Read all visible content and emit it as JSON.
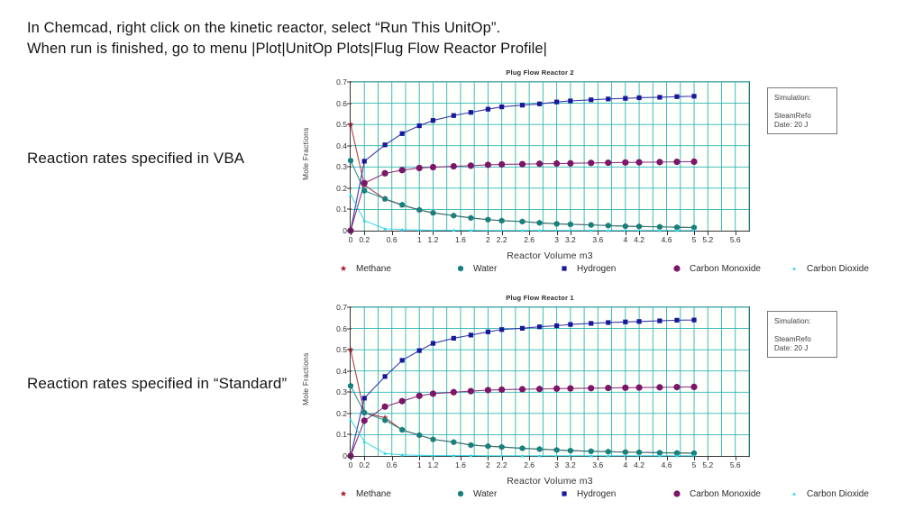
{
  "instructions": {
    "line1": "In Chemcad, right click on the kinetic reactor, select “Run This UnitOp”.",
    "line2": "When run is finished, go to menu |Plot|UnitOp Plots|Flug Flow Reactor Profile|"
  },
  "captions": {
    "chart1": "Reaction rates specified in VBA",
    "chart2": "Reaction rates specified in “Standard”"
  },
  "simulation_box": {
    "label": "Simulation:",
    "value": "SteamRefo",
    "value_clipped": "Date: 20 J"
  },
  "colors": {
    "methane": "#a81f2e",
    "water": "#15807d",
    "hydrogen": "#17199c",
    "carbon_monoxide": "#7b1668",
    "carbon_dioxide": "#2ad4e8",
    "grid": "#2bb5b5",
    "axis": "#333333",
    "plot_bg": "#fffffb"
  },
  "chart_data": [
    {
      "type": "line",
      "title": "Plug Flow Reactor 2",
      "xlabel": "Reactor Volume m3",
      "ylabel": "Mole Fractions",
      "xlim": [
        0,
        5.8
      ],
      "ylim": [
        0,
        0.7
      ],
      "grid": true,
      "legend_position": "bottom",
      "yticks": [
        "0",
        "0.1",
        "0.2",
        "0.3",
        "0.4",
        "0.5",
        "0.6",
        "0.7"
      ],
      "ytick_values": [
        0,
        0.1,
        0.2,
        0.3,
        0.4,
        0.5,
        0.6,
        0.7
      ],
      "xticks": [
        "0",
        "0.2",
        "0.6",
        "1",
        "1.2",
        "1.6",
        "2",
        "2.2",
        "2.6",
        "3",
        "3.2",
        "3.6",
        "4",
        "4.2",
        "4.6",
        "5",
        "5.2",
        "5.6"
      ],
      "xtick_values": [
        0,
        0.2,
        0.6,
        1,
        1.2,
        1.6,
        2,
        2.2,
        2.6,
        3,
        3.2,
        3.6,
        4,
        4.2,
        4.6,
        5,
        5.2,
        5.6
      ],
      "x": [
        0,
        0.2,
        0.5,
        0.75,
        1,
        1.2,
        1.5,
        1.75,
        2,
        2.2,
        2.5,
        2.75,
        3,
        3.2,
        3.5,
        3.75,
        4,
        4.2,
        4.5,
        4.75,
        5
      ],
      "series": [
        {
          "name": "Methane",
          "marker": "star",
          "color": "#a81f2e",
          "values": [
            0.5,
            0.215,
            0.148,
            0.12,
            0.097,
            0.083,
            0.071,
            0.06,
            0.052,
            0.047,
            0.043,
            0.037,
            0.032,
            0.03,
            0.027,
            0.024,
            0.021,
            0.02,
            0.018,
            0.016,
            0.015
          ]
        },
        {
          "name": "Water",
          "marker": "hexagon",
          "color": "#15807d",
          "values": [
            0.33,
            0.188,
            0.15,
            0.122,
            0.098,
            0.084,
            0.071,
            0.06,
            0.052,
            0.047,
            0.043,
            0.037,
            0.032,
            0.03,
            0.027,
            0.024,
            0.021,
            0.02,
            0.018,
            0.016,
            0.015
          ]
        },
        {
          "name": "Hydrogen",
          "marker": "square",
          "color": "#17199c",
          "values": [
            0.0,
            0.327,
            0.404,
            0.457,
            0.494,
            0.519,
            0.542,
            0.557,
            0.572,
            0.583,
            0.591,
            0.597,
            0.606,
            0.611,
            0.616,
            0.62,
            0.623,
            0.626,
            0.628,
            0.631,
            0.633
          ]
        },
        {
          "name": "Carbon Monoxide",
          "marker": "circle",
          "color": "#7b1668",
          "values": [
            0.0,
            0.224,
            0.27,
            0.285,
            0.295,
            0.299,
            0.303,
            0.306,
            0.31,
            0.312,
            0.313,
            0.315,
            0.316,
            0.317,
            0.319,
            0.32,
            0.321,
            0.322,
            0.323,
            0.324,
            0.325
          ]
        },
        {
          "name": "Carbon Dioxide",
          "marker": "tiny",
          "color": "#2ad4e8",
          "values": [
            0.17,
            0.047,
            0.009,
            0.005,
            0.003,
            0.002,
            0.002,
            0.002,
            0.001,
            0.001,
            0.001,
            0.001,
            0.001,
            0.001,
            0.001,
            0.001,
            0.001,
            0.001,
            0.001,
            0.001,
            0.001
          ]
        }
      ]
    },
    {
      "type": "line",
      "title": "Plug Flow Reactor 1",
      "xlabel": "Reactor Volume m3",
      "ylabel": "Mole Fractions",
      "xlim": [
        0,
        5.8
      ],
      "ylim": [
        0,
        0.7
      ],
      "grid": true,
      "legend_position": "bottom",
      "yticks": [
        "0",
        "0.1",
        "0.2",
        "0.3",
        "0.4",
        "0.5",
        "0.6",
        "0.7"
      ],
      "ytick_values": [
        0,
        0.1,
        0.2,
        0.3,
        0.4,
        0.5,
        0.6,
        0.7
      ],
      "xticks": [
        "0",
        "0.2",
        "0.6",
        "1",
        "1.2",
        "1.6",
        "2",
        "2.2",
        "2.6",
        "3",
        "3.2",
        "3.6",
        "4",
        "4.2",
        "4.6",
        "5",
        "5.2",
        "5.6"
      ],
      "xtick_values": [
        0,
        0.2,
        0.6,
        1,
        1.2,
        1.6,
        2,
        2.2,
        2.6,
        3,
        3.2,
        3.6,
        4,
        4.2,
        4.6,
        5,
        5.2,
        5.6
      ],
      "x": [
        0,
        0.2,
        0.5,
        0.75,
        1,
        1.2,
        1.5,
        1.75,
        2,
        2.2,
        2.5,
        2.75,
        3,
        3.2,
        3.5,
        3.75,
        4,
        4.2,
        4.5,
        4.75,
        5
      ],
      "series": [
        {
          "name": "Methane",
          "marker": "star",
          "color": "#a81f2e",
          "values": [
            0.5,
            0.203,
            0.18,
            0.122,
            0.097,
            0.078,
            0.065,
            0.051,
            0.046,
            0.042,
            0.036,
            0.032,
            0.028,
            0.025,
            0.022,
            0.02,
            0.018,
            0.017,
            0.015,
            0.014,
            0.013
          ]
        },
        {
          "name": "Water",
          "marker": "hexagon",
          "color": "#15807d",
          "values": [
            0.33,
            0.204,
            0.168,
            0.123,
            0.098,
            0.078,
            0.065,
            0.051,
            0.046,
            0.042,
            0.036,
            0.032,
            0.028,
            0.025,
            0.022,
            0.02,
            0.018,
            0.017,
            0.015,
            0.014,
            0.013
          ]
        },
        {
          "name": "Hydrogen",
          "marker": "square",
          "color": "#17199c",
          "values": [
            0.0,
            0.272,
            0.374,
            0.45,
            0.496,
            0.53,
            0.554,
            0.569,
            0.584,
            0.595,
            0.601,
            0.608,
            0.613,
            0.619,
            0.624,
            0.628,
            0.631,
            0.633,
            0.636,
            0.639,
            0.64
          ]
        },
        {
          "name": "Carbon Monoxide",
          "marker": "circle",
          "color": "#7b1668",
          "values": [
            0.0,
            0.166,
            0.232,
            0.258,
            0.283,
            0.293,
            0.3,
            0.305,
            0.31,
            0.312,
            0.314,
            0.315,
            0.317,
            0.318,
            0.319,
            0.32,
            0.321,
            0.322,
            0.323,
            0.324,
            0.325
          ]
        },
        {
          "name": "Carbon Dioxide",
          "marker": "tiny",
          "color": "#2ad4e8",
          "values": [
            0.17,
            0.067,
            0.012,
            0.005,
            0.003,
            0.002,
            0.002,
            0.002,
            0.001,
            0.001,
            0.001,
            0.001,
            0.001,
            0.001,
            0.001,
            0.001,
            0.001,
            0.001,
            0.001,
            0.001,
            0.001
          ]
        }
      ]
    }
  ]
}
